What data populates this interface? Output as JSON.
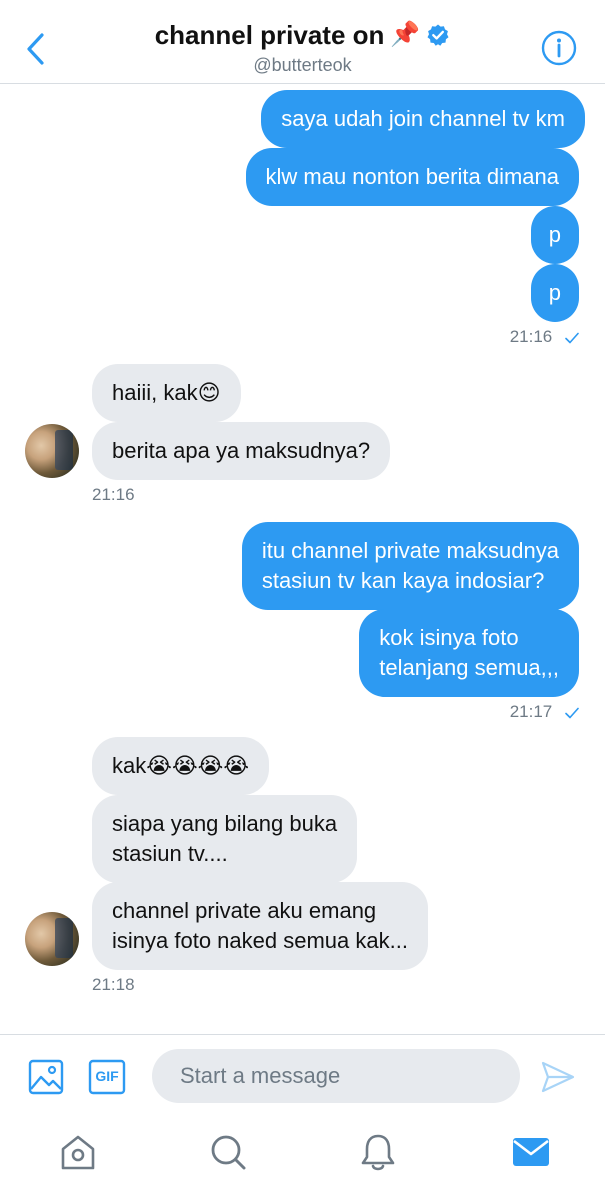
{
  "header": {
    "title": "channel private on",
    "title_emoji": "📌",
    "handle": "@butterteok"
  },
  "messages": {
    "out1": "saya udah join channel tv km",
    "out2": "klw mau nonton berita dimana",
    "out3": "p",
    "out4": "p",
    "time1": "21:16",
    "in1_text": "haiii, kak",
    "in1_emoji": "😊",
    "in2": "berita apa ya maksudnya?",
    "time2": "21:16",
    "out5_l1": "itu channel private maksudnya",
    "out5_l2": "stasiun tv kan kaya indosiar?",
    "out6_l1": "kok isinya foto",
    "out6_l2": "telanjang semua,,,",
    "time3": "21:17",
    "in3_text": "kak",
    "in3_emoji": "😭😭😭😭",
    "in4_l1": "siapa yang bilang buka",
    "in4_l2": "stasiun tv....",
    "in5_l1": "channel private aku emang",
    "in5_l2": "isinya foto naked semua kak...",
    "time4": "21:18"
  },
  "composer": {
    "placeholder": "Start a message",
    "gif_label": "GIF"
  },
  "colors": {
    "accent": "#2d9af2",
    "incoming_bubble": "#e7eaee",
    "muted_text": "#6e7a85"
  },
  "icons": {
    "back": "chevron-left-icon",
    "verified": "verified-badge-icon",
    "info": "info-icon",
    "image": "image-icon",
    "gif": "gif-icon",
    "send": "send-icon",
    "home": "home-icon",
    "search": "search-icon",
    "notifications": "bell-icon",
    "messages": "mail-icon"
  }
}
